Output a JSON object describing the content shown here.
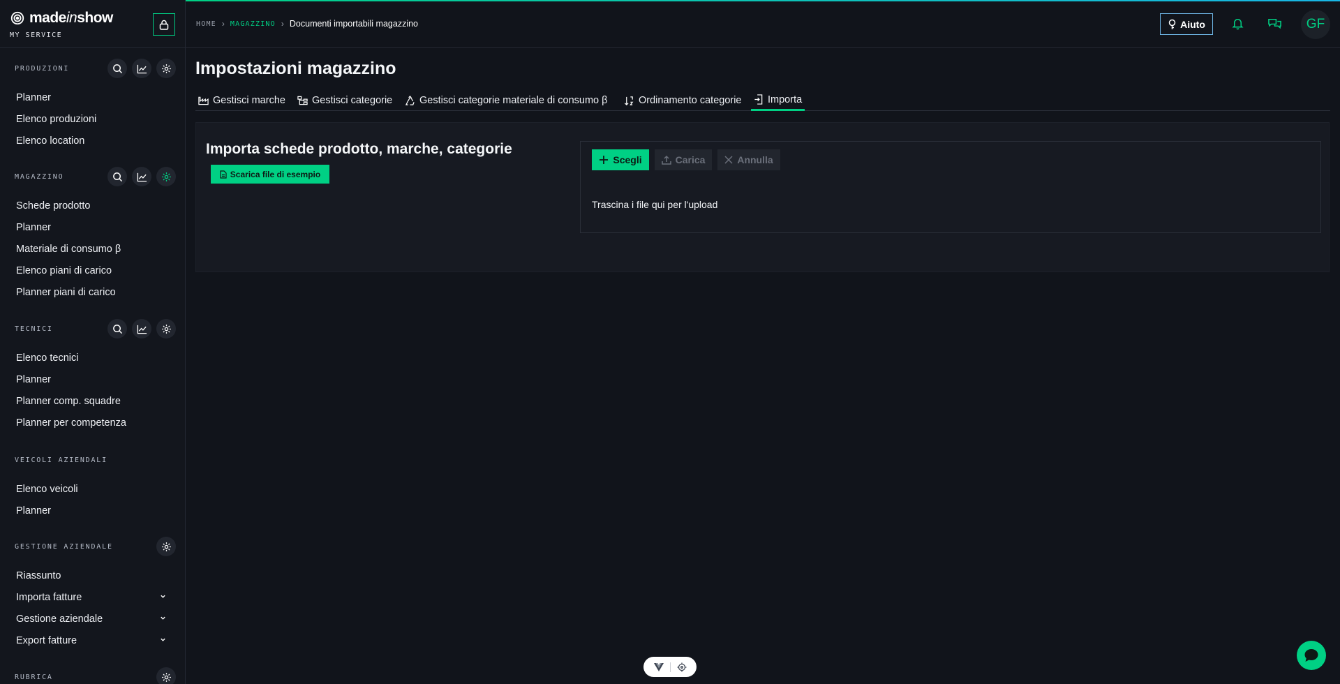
{
  "brand": {
    "name_main": "made",
    "name_italic": "in",
    "name_end": "show",
    "subtitle": "MY SERVICE"
  },
  "colors": {
    "accent": "#00d084",
    "background": "#11141b",
    "panel": "#171a22",
    "help_border": "#6fb6e6"
  },
  "sidebar": {
    "sections": [
      {
        "title": "PRODUZIONI",
        "icons": [
          "search-icon",
          "chart-icon",
          "gear-icon"
        ],
        "items": [
          "Planner",
          "Elenco produzioni",
          "Elenco location"
        ]
      },
      {
        "title": "MAGAZZINO",
        "icons": [
          "search-icon",
          "chart-icon",
          "gear-icon"
        ],
        "items": [
          "Schede prodotto",
          "Planner",
          "Materiale di consumo β",
          "Elenco piani di carico",
          "Planner piani di carico"
        ]
      },
      {
        "title": "TECNICI",
        "icons": [
          "search-icon",
          "chart-icon",
          "gear-icon"
        ],
        "items": [
          "Elenco tecnici",
          "Planner",
          "Planner comp. squadre",
          "Planner per competenza"
        ]
      },
      {
        "title": "VEICOLI AZIENDALI",
        "items": [
          "Elenco veicoli",
          "Planner"
        ]
      },
      {
        "title": "GESTIONE AZIENDALE",
        "icons": [
          "gear-icon"
        ],
        "items": [
          "Riassunto",
          "Importa fatture",
          "Gestione aziendale",
          "Export fatture"
        ]
      },
      {
        "title": "RUBRICA",
        "icons": [
          "gear-icon"
        ],
        "items": []
      }
    ]
  },
  "header": {
    "breadcrumb": {
      "home": "HOME",
      "section": "MAGAZZINO",
      "current": "Documenti importabili magazzino"
    },
    "help_label": "Aiuto",
    "avatar_initials": "GF"
  },
  "main": {
    "title": "Impostazioni magazzino",
    "tabs": [
      {
        "label": "Gestisci marche",
        "icon": "factory-icon"
      },
      {
        "label": "Gestisci categorie",
        "icon": "hierarchy-icon"
      },
      {
        "label": "Gestisci categorie materiale di consumo β",
        "icon": "recycle-icon"
      },
      {
        "label": "Ordinamento categorie",
        "icon": "sort-icon"
      },
      {
        "label": "Importa",
        "icon": "import-icon",
        "active": true
      }
    ],
    "panel": {
      "title": "Importa schede prodotto, marche, categorie",
      "sample_button": "Scarica file di esempio",
      "upload": {
        "choose_label": "Scegli",
        "upload_label": "Carica",
        "cancel_label": "Annulla",
        "drop_text": "Trascina i file qui per l'upload"
      }
    }
  }
}
